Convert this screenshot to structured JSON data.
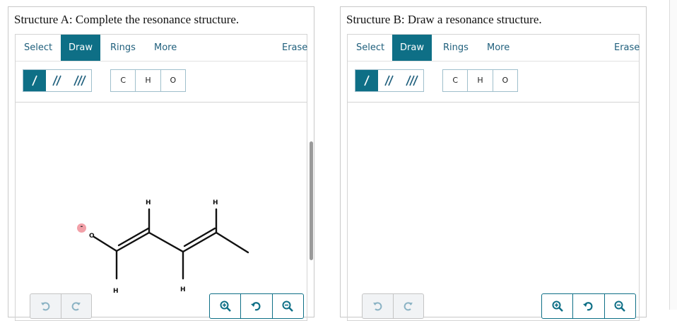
{
  "panels": {
    "a": {
      "title": "Structure A: Complete the resonance structure.",
      "tabs": {
        "select": "Select",
        "draw": "Draw",
        "rings": "Rings",
        "more": "More",
        "erase": "Erase"
      },
      "elements": {
        "c": "C",
        "h": "H",
        "o": "O"
      },
      "molecule": {
        "atoms": {
          "o": "O",
          "h1": "H",
          "h2": "H",
          "h3": "H",
          "h4": "H"
        },
        "charge": "-"
      }
    },
    "b": {
      "title": "Structure B: Draw a resonance structure.",
      "tabs": {
        "select": "Select",
        "draw": "Draw",
        "rings": "Rings",
        "more": "More",
        "erase": "Erase"
      },
      "elements": {
        "c": "C",
        "h": "H",
        "o": "O"
      }
    }
  },
  "colors": {
    "accent": "#0e6f86",
    "charge": "#f2a0a8"
  },
  "icons": {
    "single_bond": "single-bond-icon",
    "double_bond": "double-bond-icon",
    "triple_bond": "triple-bond-icon",
    "undo": "undo-icon",
    "redo": "redo-icon",
    "zoom_in": "zoom-in-icon",
    "zoom_reset": "zoom-reset-icon",
    "zoom_out": "zoom-out-icon"
  }
}
